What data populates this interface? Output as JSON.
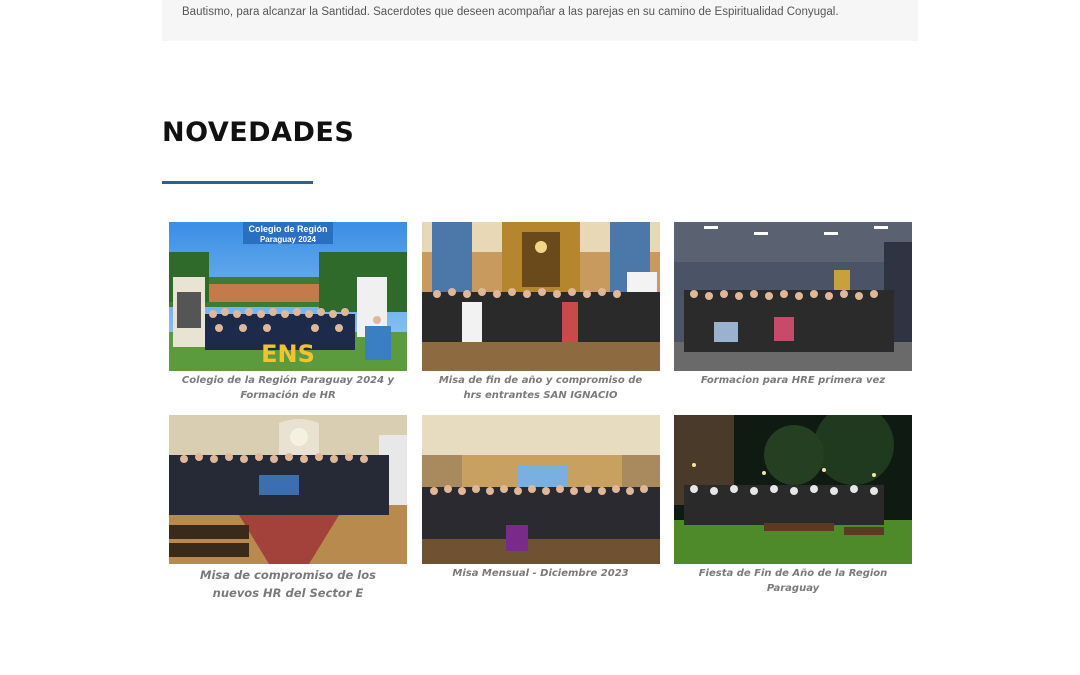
{
  "intro": {
    "text": "Bautismo, para alcanzar la Santidad. Sacerdotes que deseen acompañar a las parejas en su camino de Espiritualidad Conyugal."
  },
  "section": {
    "title": "NOVEDADES"
  },
  "news": [
    {
      "caption": "Colegio de la Región Paraguay 2024 y Formación de HR",
      "photo_banner_title": "Colegio de Región",
      "photo_banner_subtitle": "Paraguay 2024",
      "photo_letters": "ENS"
    },
    {
      "caption": "Misa de fin de año y compromiso de hrs entrantes SAN IGNACIO"
    },
    {
      "caption": "Formacion para HRE primera vez"
    },
    {
      "caption": "Misa de compromiso de los nuevos HR del Sector E"
    },
    {
      "caption": "Misa Mensual - Diciembre 2023"
    },
    {
      "caption": "Fiesta de Fin de Año de la Region Paraguay"
    }
  ],
  "colors": {
    "underline": "#2f5f8a",
    "caption": "#7a7a7a",
    "title": "#111111"
  }
}
